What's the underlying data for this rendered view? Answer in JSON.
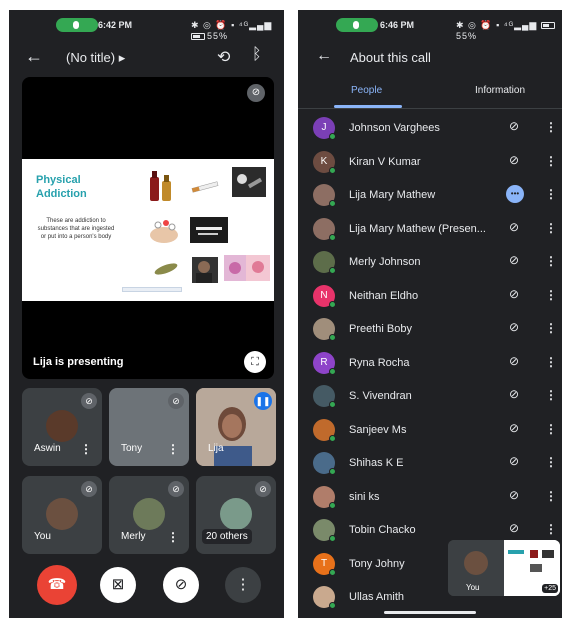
{
  "left_phone": {
    "status_bar": {
      "time": "6:42 PM",
      "battery": "55"
    },
    "header": {
      "title": "(No title)",
      "back_icon": "arrow-left-icon",
      "switch_camera_icon": "flip-camera-icon",
      "audio_icon": "bluetooth-icon"
    },
    "presentation": {
      "slide_title": "Physical Addiction",
      "slide_body": "These are addiction to substances that are ingested or put into a person's body",
      "presenter_label": "Lija is presenting"
    },
    "tiles": [
      {
        "name": "Aswin",
        "muted": true
      },
      {
        "name": "Tony",
        "muted": true
      },
      {
        "name": "Lija",
        "speaking": true
      },
      {
        "name": "You",
        "muted": true
      },
      {
        "name": "Merly",
        "muted": true
      },
      {
        "name": "",
        "others_label": "20 others",
        "muted": true
      }
    ],
    "controls": {
      "end_call_icon": "phone-hangup-icon",
      "camera_icon": "camera-off-icon",
      "mic_icon": "mic-off-icon",
      "more_icon": "more-vertical-icon"
    },
    "colors": {
      "end_call": "#ea4335",
      "slide_title": "#27a1ad"
    }
  },
  "right_phone": {
    "status_bar": {
      "time": "6:46 PM",
      "battery": "55"
    },
    "header": {
      "title": "About this call",
      "back_icon": "arrow-left-icon"
    },
    "tabs": [
      {
        "label": "People",
        "active": true
      },
      {
        "label": "Information",
        "active": false
      }
    ],
    "participants": [
      {
        "name": "Johnson Varghees",
        "initial": "J",
        "color": "#7b3fb6",
        "mic": "muted"
      },
      {
        "name": "Kiran V Kumar",
        "initial": "K",
        "color": "#6d4c41",
        "mic": "muted"
      },
      {
        "name": "Lija Mary Mathew",
        "initial": "",
        "color": "#8d6e63",
        "mic": "speaking"
      },
      {
        "name": "Lija Mary Mathew (Presen...",
        "initial": "",
        "color": "#8d6e63",
        "mic": "muted"
      },
      {
        "name": "Merly Johnson",
        "initial": "",
        "color": "#5d6d4a",
        "mic": "muted"
      },
      {
        "name": "Neithan Eldho",
        "initial": "N",
        "color": "#e8336a",
        "mic": "muted"
      },
      {
        "name": "Preethi Boby",
        "initial": "",
        "color": "#a08e7b",
        "mic": "muted"
      },
      {
        "name": "Ryna Rocha",
        "initial": "R",
        "color": "#8e44c9",
        "mic": "muted"
      },
      {
        "name": "S. Vivendran",
        "initial": "",
        "color": "#455a64",
        "mic": "muted"
      },
      {
        "name": "Sanjeev Ms",
        "initial": "",
        "color": "#c06a2c",
        "mic": "muted"
      },
      {
        "name": "Shihas K E",
        "initial": "",
        "color": "#4a6b8a",
        "mic": "muted"
      },
      {
        "name": "sini ks",
        "initial": "",
        "color": "#b07d6a",
        "mic": "muted"
      },
      {
        "name": "Tobin Chacko",
        "initial": "",
        "color": "#7a8a6a",
        "mic": "muted"
      },
      {
        "name": "Tony Johny",
        "initial": "T",
        "color": "#e8711a",
        "mic": "hidden"
      },
      {
        "name": "Ullas Amith",
        "initial": "",
        "color": "#c9a98e",
        "mic": "hidden"
      }
    ],
    "pip": {
      "you_label": "You",
      "plus_count": "+25"
    },
    "colors": {
      "accent": "#8ab4f8",
      "online": "#34a853"
    }
  }
}
